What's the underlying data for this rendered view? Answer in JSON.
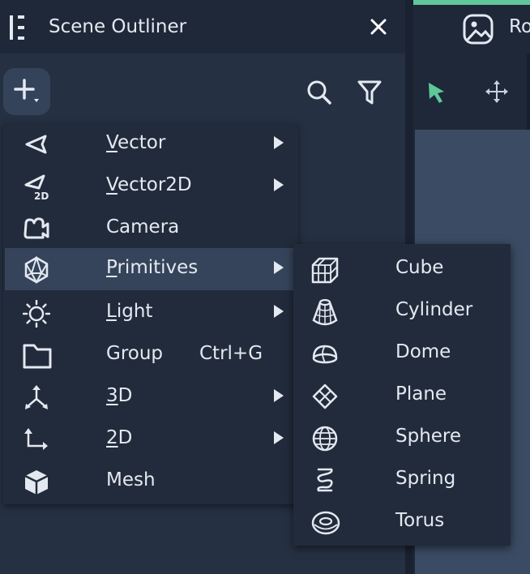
{
  "outliner": {
    "title": "Scene Outliner",
    "icons": {
      "grip": "outliner-grip-icon",
      "close": "close-icon",
      "add": "add-icon",
      "search": "search-icon",
      "filter": "filter-icon"
    }
  },
  "right_tab": {
    "label_fragment": "Ro",
    "accent": "#5fc79a"
  },
  "menu": {
    "items": [
      {
        "first": "V",
        "rest": "ector",
        "shortcut": "",
        "icon": "vector-icon",
        "has_submenu": true
      },
      {
        "first": "V",
        "rest": "ector2D",
        "shortcut": "",
        "icon": "vector2d-icon",
        "has_submenu": true
      },
      {
        "first": "",
        "rest": "Camera",
        "shortcut": "",
        "icon": "camera-icon",
        "has_submenu": false
      },
      {
        "first": "P",
        "rest": "rimitives",
        "shortcut": "",
        "icon": "primitives-icon",
        "has_submenu": true
      },
      {
        "first": "L",
        "rest": "ight",
        "shortcut": "",
        "icon": "light-icon",
        "has_submenu": true
      },
      {
        "first": "",
        "rest": "Group",
        "shortcut": "Ctrl+G",
        "icon": "group-folder-icon",
        "has_submenu": false
      },
      {
        "first": "3",
        "rest": "D",
        "shortcut": "",
        "icon": "3d-axes-icon",
        "has_submenu": true
      },
      {
        "first": "2",
        "rest": "D",
        "shortcut": "",
        "icon": "2d-axes-icon",
        "has_submenu": true
      },
      {
        "first": "",
        "rest": "Mesh",
        "shortcut": "",
        "icon": "mesh-icon",
        "has_submenu": false
      }
    ],
    "highlighted": "Primitives"
  },
  "submenu": {
    "items": [
      {
        "label": "Cube",
        "icon": "cube-icon"
      },
      {
        "label": "Cylinder",
        "icon": "cylinder-icon"
      },
      {
        "label": "Dome",
        "icon": "dome-icon"
      },
      {
        "label": "Plane",
        "icon": "plane-icon"
      },
      {
        "label": "Sphere",
        "icon": "sphere-icon"
      },
      {
        "label": "Spring",
        "icon": "spring-icon"
      },
      {
        "label": "Torus",
        "icon": "torus-icon"
      }
    ]
  }
}
